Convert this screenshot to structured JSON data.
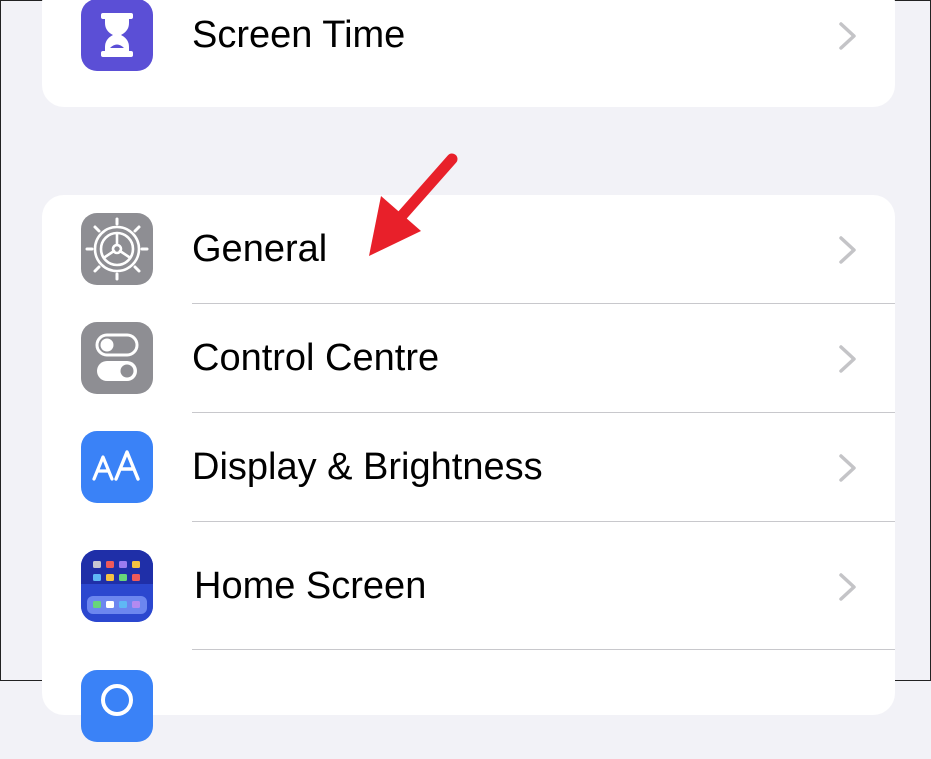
{
  "rows_top": [
    {
      "id": "screen-time",
      "label": "Screen Time",
      "icon": "hourglass-icon",
      "icon_color": "#5b4fd6"
    }
  ],
  "rows_main": [
    {
      "id": "general",
      "label": "General",
      "icon": "gear-icon",
      "icon_color": "#8e8e93"
    },
    {
      "id": "control-centre",
      "label": "Control Centre",
      "icon": "toggles-icon",
      "icon_color": "#8e8e93"
    },
    {
      "id": "display-brightness",
      "label": "Display & Brightness",
      "icon": "text-size-icon",
      "icon_color": "#3a82f7"
    },
    {
      "id": "home-screen",
      "label": "Home Screen",
      "icon": "app-grid-icon",
      "icon_color": "#2b47cf"
    }
  ],
  "annotation": {
    "icon": "red-arrow-icon",
    "color": "#e8202a"
  }
}
